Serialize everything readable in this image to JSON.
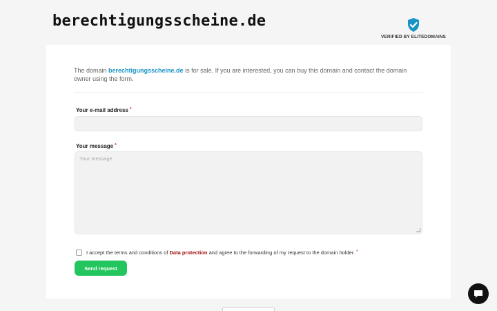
{
  "header": {
    "domain": "berechtigungsscheine.de",
    "verified_label": "VERIFIED BY ELITEDOMAINS"
  },
  "intro": {
    "prefix": "The domain ",
    "domain_link": "berechtigungsscheine.de",
    "suffix": " is for sale. If you are interested, you can buy this domain and contact the domain owner using the form."
  },
  "form": {
    "email_label": "Your e-mail address",
    "message_label": "Your message",
    "message_placeholder": "Your message",
    "required_mark": "*",
    "terms_prefix": "I accept the terms and conditions of ",
    "terms_link": "Data protection",
    "terms_suffix": " and agree to the forwarding of my request to the domain holder.",
    "send_label": "Send request"
  },
  "icons": {
    "verified": "shield-check-icon",
    "chat": "chat-bubble-icon"
  },
  "colors": {
    "accent_link": "#1a93c5",
    "button": "#22c55e",
    "shield": "#1a93c5",
    "data_protection_link": "#a01010"
  }
}
